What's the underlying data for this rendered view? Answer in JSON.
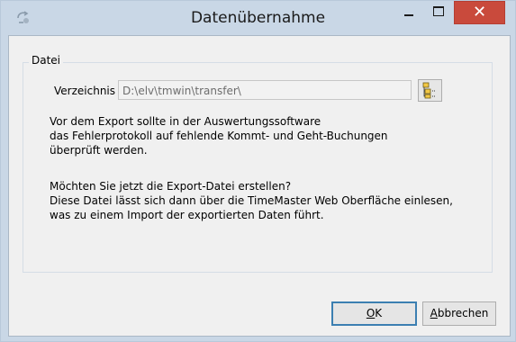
{
  "window": {
    "title": "Datenübernahme",
    "close_glyph": "✕",
    "icons": {
      "app": "exchange-icon",
      "minimize": "minimize-icon",
      "maximize": "maximize-icon",
      "close": "close-icon"
    },
    "colors": {
      "frame": "#c9d7e6",
      "close_button": "#c94a3c"
    }
  },
  "group": {
    "legend": "Datei",
    "directory_label": "Verzeichnis",
    "directory_value": "D:\\elv\\tmwin\\transfer\\",
    "browse_icon": "folder-tree-icon"
  },
  "message": {
    "paragraph1_lines": [
      "Vor dem Export sollte in der Auswertungssoftware",
      "das Fehlerprotokoll auf fehlende Kommt- und Geht-Buchungen",
      "überprüft werden."
    ],
    "paragraph2_lines": [
      "Möchten Sie jetzt die Export-Datei erstellen?",
      "Diese Datei lässt sich dann über die TimeMaster Web Oberfläche einlesen,",
      "was zu einem Import der exportierten Daten führt."
    ]
  },
  "buttons": {
    "ok": {
      "mnemonic": "O",
      "rest": "K"
    },
    "cancel": {
      "mnemonic": "A",
      "rest": "bbrechen"
    }
  }
}
